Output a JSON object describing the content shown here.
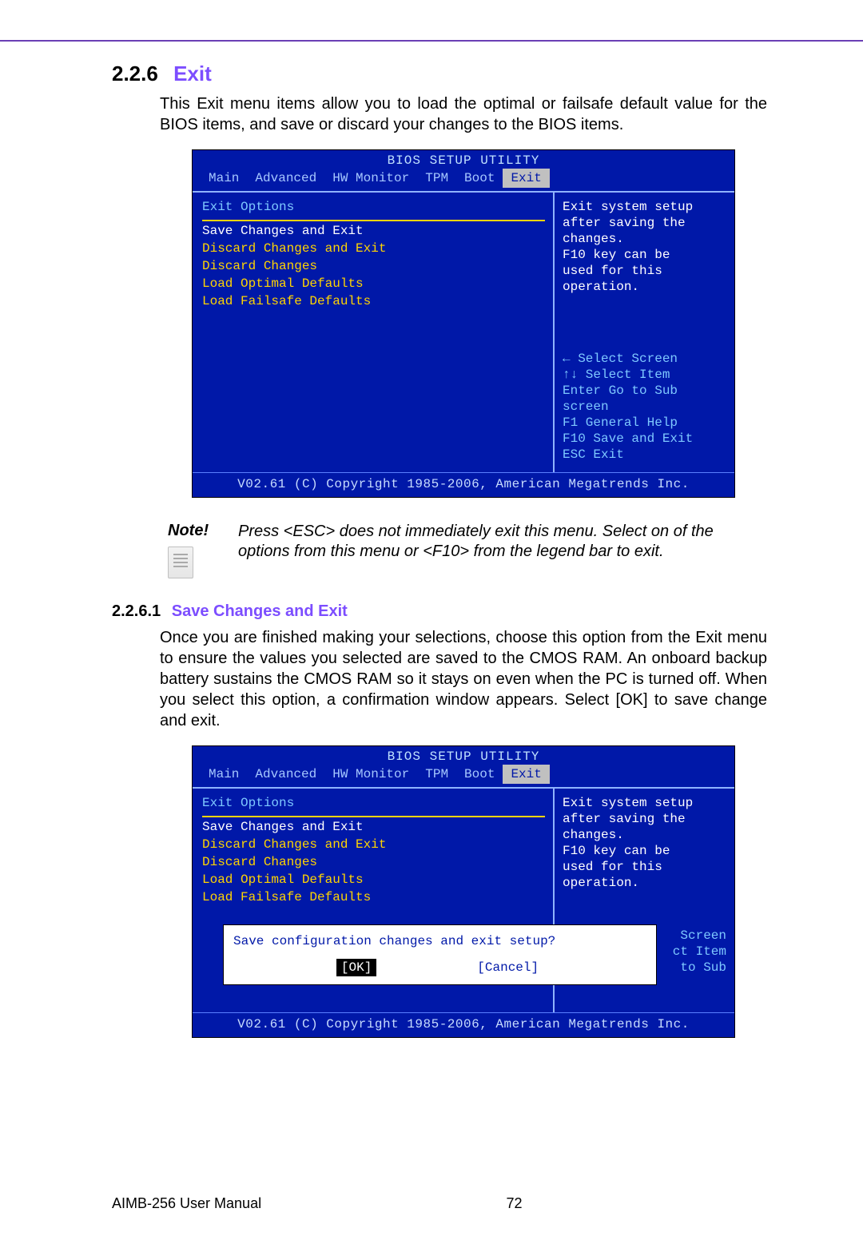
{
  "section": {
    "number": "2.2.6",
    "title": "Exit"
  },
  "intro": "This Exit menu items allow you to load the optimal or failsafe default value for the BIOS items, and save or discard your changes to the BIOS items.",
  "note": {
    "label": "Note!",
    "text": "Press <ESC> does not immediately exit this menu. Select on of the options from this menu or <F10> from the legend bar to exit."
  },
  "subsection": {
    "number": "2.2.6.1",
    "title": "Save Changes and Exit"
  },
  "sub_body": "Once you are finished making your selections, choose this option from the Exit menu to ensure the values you selected are saved to the CMOS RAM. An onboard backup battery sustains the CMOS RAM so it stays on even when the PC is turned off. When you select this option, a confirmation window appears. Select [OK] to save change and exit.",
  "footer": {
    "manual": "AIMB-256 User Manual",
    "page": "72"
  },
  "bios": {
    "title": "BIOS SETUP UTILITY",
    "tabs": [
      "Main",
      "Advanced",
      "HW Monitor",
      "TPM",
      "Boot",
      "Exit"
    ],
    "active_tab": "Exit",
    "left_heading": "Exit Options",
    "options": [
      "Save Changes and Exit",
      "Discard Changes and Exit",
      "Discard Changes",
      "",
      "Load Optimal Defaults",
      "Load Failsafe Defaults"
    ],
    "selected_index": 0,
    "help_top": [
      "Exit system setup",
      "after saving the",
      "changes.",
      "",
      "F10 key can be",
      "used for this",
      "operation."
    ],
    "nav": {
      "l1": "← Select Screen",
      "l2": "↑↓ Select Item",
      "l3": "Enter Go to Sub",
      "l4": "screen",
      "l5": "F1  General Help",
      "l6": "F10 Save and Exit",
      "l7": "ESC Exit"
    },
    "footer": "V02.61 (C) Copyright 1985-2006, American Megatrends Inc.",
    "dialog": {
      "prompt": "Save configuration changes and exit setup?",
      "ok": "[OK]",
      "cancel": "[Cancel]"
    },
    "right_partial": {
      "a": "Screen",
      "b": "ct Item",
      "c": "to Sub"
    }
  }
}
